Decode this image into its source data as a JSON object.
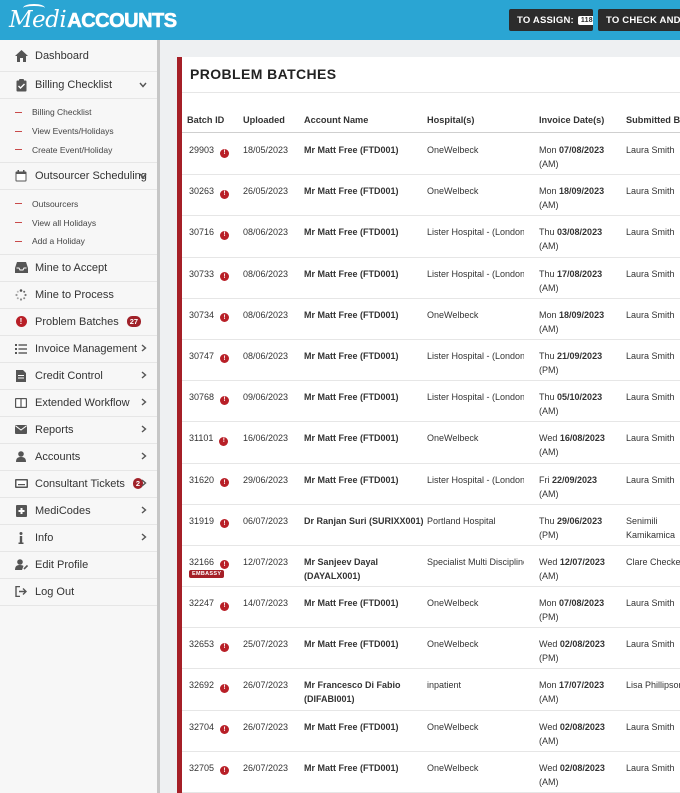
{
  "logo": {
    "part1": "Medi",
    "part2": "ACCOUNTS"
  },
  "topbar": {
    "assign_label": "TO ASSIGN:",
    "assign_count": "118",
    "check_label": "TO CHECK AND PR"
  },
  "sidebar": {
    "dashboard": "Dashboard",
    "billing_checklist": "Billing Checklist",
    "billing_sub": [
      "Billing Checklist",
      "View Events/Holidays",
      "Create Event/Holiday"
    ],
    "outsourcer_scheduling": "Outsourcer Scheduling",
    "outsourcer_sub": [
      "Outsourcers",
      "View all Holidays",
      "Add a Holiday"
    ],
    "mine_to_accept": "Mine to Accept",
    "mine_to_process": "Mine to Process",
    "problem_batches": "Problem Batches",
    "problem_batches_count": "27",
    "invoice_management": "Invoice Management",
    "credit_control": "Credit Control",
    "extended_workflow": "Extended Workflow",
    "reports": "Reports",
    "accounts": "Accounts",
    "consultant_tickets": "Consultant Tickets",
    "consultant_tickets_count": "2",
    "medicodes": "MediCodes",
    "info": "Info",
    "edit_profile": "Edit Profile",
    "log_out": "Log Out"
  },
  "main": {
    "title": "PROBLEM BATCHES",
    "columns": [
      "Batch ID",
      "Uploaded",
      "Account Name",
      "Hospital(s)",
      "Invoice Date(s)",
      "Submitted By"
    ],
    "rows": [
      {
        "id": "29903",
        "uploaded": "18/05/2023",
        "account": "Mr Matt Free (FTD001)",
        "hospital": "OneWelbeck",
        "inv_day": "Mon",
        "inv_date": "07/08/2023",
        "inv_ampm": "(AM)",
        "submitted": "Laura Smith"
      },
      {
        "id": "30263",
        "uploaded": "26/05/2023",
        "account": "Mr Matt Free (FTD001)",
        "hospital": "OneWelbeck",
        "inv_day": "Mon",
        "inv_date": "18/09/2023",
        "inv_ampm": "(AM)",
        "submitted": "Laura Smith"
      },
      {
        "id": "30716",
        "uploaded": "08/06/2023",
        "account": "Mr Matt Free (FTD001)",
        "hospital": "Lister Hospital - (London)",
        "inv_day": "Thu",
        "inv_date": "03/08/2023",
        "inv_ampm": "(AM)",
        "submitted": "Laura Smith"
      },
      {
        "id": "30733",
        "uploaded": "08/06/2023",
        "account": "Mr Matt Free (FTD001)",
        "hospital": "Lister Hospital - (London)",
        "inv_day": "Thu",
        "inv_date": "17/08/2023",
        "inv_ampm": "(AM)",
        "submitted": "Laura Smith"
      },
      {
        "id": "30734",
        "uploaded": "08/06/2023",
        "account": "Mr Matt Free (FTD001)",
        "hospital": "OneWelbeck",
        "inv_day": "Mon",
        "inv_date": "18/09/2023",
        "inv_ampm": "(AM)",
        "submitted": "Laura Smith"
      },
      {
        "id": "30747",
        "uploaded": "08/06/2023",
        "account": "Mr Matt Free (FTD001)",
        "hospital": "Lister Hospital - (London)",
        "inv_day": "Thu",
        "inv_date": "21/09/2023",
        "inv_ampm": "(PM)",
        "submitted": "Laura Smith"
      },
      {
        "id": "30768",
        "uploaded": "09/06/2023",
        "account": "Mr Matt Free (FTD001)",
        "hospital": "Lister Hospital - (London)",
        "inv_day": "Thu",
        "inv_date": "05/10/2023",
        "inv_ampm": "(AM)",
        "submitted": "Laura Smith"
      },
      {
        "id": "31101",
        "uploaded": "16/06/2023",
        "account": "Mr Matt Free (FTD001)",
        "hospital": "OneWelbeck",
        "inv_day": "Wed",
        "inv_date": "16/08/2023",
        "inv_ampm": "(AM)",
        "submitted": "Laura Smith"
      },
      {
        "id": "31620",
        "uploaded": "29/06/2023",
        "account": "Mr Matt Free (FTD001)",
        "hospital": "Lister Hospital - (London)",
        "inv_day": "Fri",
        "inv_date": "22/09/2023",
        "inv_ampm": "(AM)",
        "submitted": "Laura Smith"
      },
      {
        "id": "31919",
        "uploaded": "06/07/2023",
        "account": "Dr Ranjan Suri (SURIXX001)",
        "hospital": "Portland Hospital",
        "inv_day": "Thu",
        "inv_date": "29/06/2023",
        "inv_ampm": "(PM)",
        "submitted": "Senimili Kamikamica"
      },
      {
        "id": "32166",
        "uploaded": "12/07/2023",
        "account": "Mr Sanjeev Dayal (DAYALX001)",
        "hospital": "Specialist Multi Discipline",
        "inv_day": "Wed",
        "inv_date": "12/07/2023",
        "inv_ampm": "(AM)",
        "submitted": "Clare Checke",
        "tag": "EMBASSY"
      },
      {
        "id": "32247",
        "uploaded": "14/07/2023",
        "account": "Mr Matt Free (FTD001)",
        "hospital": "OneWelbeck",
        "inv_day": "Mon",
        "inv_date": "07/08/2023",
        "inv_ampm": "(PM)",
        "submitted": "Laura Smith"
      },
      {
        "id": "32653",
        "uploaded": "25/07/2023",
        "account": "Mr Matt Free (FTD001)",
        "hospital": "OneWelbeck",
        "inv_day": "Wed",
        "inv_date": "02/08/2023",
        "inv_ampm": "(PM)",
        "submitted": "Laura Smith"
      },
      {
        "id": "32692",
        "uploaded": "26/07/2023",
        "account": "Mr Francesco Di Fabio (DIFABI001)",
        "hospital": "inpatient",
        "inv_day": "Mon",
        "inv_date": "17/07/2023",
        "inv_ampm": "(AM)",
        "submitted": "Lisa Phillipson"
      },
      {
        "id": "32704",
        "uploaded": "26/07/2023",
        "account": "Mr Matt Free (FTD001)",
        "hospital": "OneWelbeck",
        "inv_day": "Wed",
        "inv_date": "02/08/2023",
        "inv_ampm": "(AM)",
        "submitted": "Laura Smith"
      },
      {
        "id": "32705",
        "uploaded": "26/07/2023",
        "account": "Mr Matt Free (FTD001)",
        "hospital": "OneWelbeck",
        "inv_day": "Wed",
        "inv_date": "02/08/2023",
        "inv_ampm": "(AM)",
        "submitted": "Laura Smith"
      }
    ]
  },
  "colors": {
    "topbar": "#2aa5d3",
    "accent_red": "#a51f27",
    "sidebar_bg": "#f7f7f7"
  }
}
